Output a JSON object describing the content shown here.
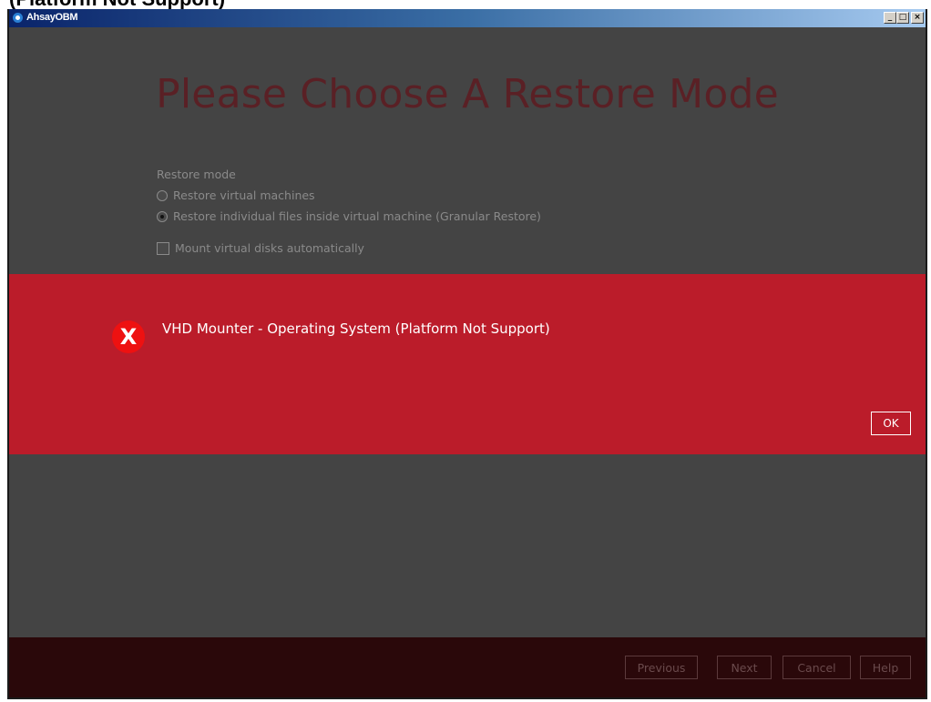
{
  "window": {
    "title": "AhsayOBM"
  },
  "header": {
    "title": "Please Choose A Restore Mode"
  },
  "restore": {
    "section_label": "Restore mode",
    "options": [
      {
        "label": "Restore virtual machines",
        "selected": false
      },
      {
        "label": "Restore individual files inside virtual machine (Granular Restore)",
        "selected": true
      }
    ],
    "mount_label": "Mount virtual disks automatically",
    "mount_checked": false
  },
  "error": {
    "icon": "error-x-icon",
    "message": "VHD Mounter - Operating System (Platform Not Support)",
    "ok_label": "OK",
    "color": "#bb1c2a"
  },
  "footer": {
    "previous_label": "Previous",
    "next_label": "Next",
    "cancel_label": "Cancel",
    "help_label": "Help"
  },
  "top_caption": {
    "text": "(Platform Not Support)"
  }
}
